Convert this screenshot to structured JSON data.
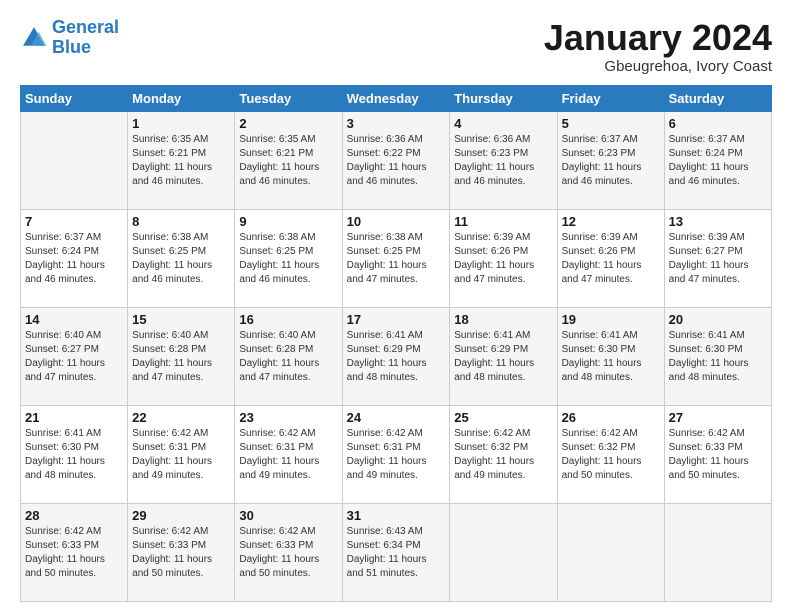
{
  "header": {
    "logo_line1": "General",
    "logo_line2": "Blue",
    "month": "January 2024",
    "location": "Gbeugrehoa, Ivory Coast"
  },
  "weekdays": [
    "Sunday",
    "Monday",
    "Tuesday",
    "Wednesday",
    "Thursday",
    "Friday",
    "Saturday"
  ],
  "weeks": [
    [
      {
        "day": "",
        "info": ""
      },
      {
        "day": "1",
        "info": "Sunrise: 6:35 AM\nSunset: 6:21 PM\nDaylight: 11 hours and 46 minutes."
      },
      {
        "day": "2",
        "info": "Sunrise: 6:35 AM\nSunset: 6:21 PM\nDaylight: 11 hours and 46 minutes."
      },
      {
        "day": "3",
        "info": "Sunrise: 6:36 AM\nSunset: 6:22 PM\nDaylight: 11 hours and 46 minutes."
      },
      {
        "day": "4",
        "info": "Sunrise: 6:36 AM\nSunset: 6:23 PM\nDaylight: 11 hours and 46 minutes."
      },
      {
        "day": "5",
        "info": "Sunrise: 6:37 AM\nSunset: 6:23 PM\nDaylight: 11 hours and 46 minutes."
      },
      {
        "day": "6",
        "info": "Sunrise: 6:37 AM\nSunset: 6:24 PM\nDaylight: 11 hours and 46 minutes."
      }
    ],
    [
      {
        "day": "7",
        "info": "Sunrise: 6:37 AM\nSunset: 6:24 PM\nDaylight: 11 hours and 46 minutes."
      },
      {
        "day": "8",
        "info": "Sunrise: 6:38 AM\nSunset: 6:25 PM\nDaylight: 11 hours and 46 minutes."
      },
      {
        "day": "9",
        "info": "Sunrise: 6:38 AM\nSunset: 6:25 PM\nDaylight: 11 hours and 46 minutes."
      },
      {
        "day": "10",
        "info": "Sunrise: 6:38 AM\nSunset: 6:25 PM\nDaylight: 11 hours and 47 minutes."
      },
      {
        "day": "11",
        "info": "Sunrise: 6:39 AM\nSunset: 6:26 PM\nDaylight: 11 hours and 47 minutes."
      },
      {
        "day": "12",
        "info": "Sunrise: 6:39 AM\nSunset: 6:26 PM\nDaylight: 11 hours and 47 minutes."
      },
      {
        "day": "13",
        "info": "Sunrise: 6:39 AM\nSunset: 6:27 PM\nDaylight: 11 hours and 47 minutes."
      }
    ],
    [
      {
        "day": "14",
        "info": "Sunrise: 6:40 AM\nSunset: 6:27 PM\nDaylight: 11 hours and 47 minutes."
      },
      {
        "day": "15",
        "info": "Sunrise: 6:40 AM\nSunset: 6:28 PM\nDaylight: 11 hours and 47 minutes."
      },
      {
        "day": "16",
        "info": "Sunrise: 6:40 AM\nSunset: 6:28 PM\nDaylight: 11 hours and 47 minutes."
      },
      {
        "day": "17",
        "info": "Sunrise: 6:41 AM\nSunset: 6:29 PM\nDaylight: 11 hours and 48 minutes."
      },
      {
        "day": "18",
        "info": "Sunrise: 6:41 AM\nSunset: 6:29 PM\nDaylight: 11 hours and 48 minutes."
      },
      {
        "day": "19",
        "info": "Sunrise: 6:41 AM\nSunset: 6:30 PM\nDaylight: 11 hours and 48 minutes."
      },
      {
        "day": "20",
        "info": "Sunrise: 6:41 AM\nSunset: 6:30 PM\nDaylight: 11 hours and 48 minutes."
      }
    ],
    [
      {
        "day": "21",
        "info": "Sunrise: 6:41 AM\nSunset: 6:30 PM\nDaylight: 11 hours and 48 minutes."
      },
      {
        "day": "22",
        "info": "Sunrise: 6:42 AM\nSunset: 6:31 PM\nDaylight: 11 hours and 49 minutes."
      },
      {
        "day": "23",
        "info": "Sunrise: 6:42 AM\nSunset: 6:31 PM\nDaylight: 11 hours and 49 minutes."
      },
      {
        "day": "24",
        "info": "Sunrise: 6:42 AM\nSunset: 6:31 PM\nDaylight: 11 hours and 49 minutes."
      },
      {
        "day": "25",
        "info": "Sunrise: 6:42 AM\nSunset: 6:32 PM\nDaylight: 11 hours and 49 minutes."
      },
      {
        "day": "26",
        "info": "Sunrise: 6:42 AM\nSunset: 6:32 PM\nDaylight: 11 hours and 50 minutes."
      },
      {
        "day": "27",
        "info": "Sunrise: 6:42 AM\nSunset: 6:33 PM\nDaylight: 11 hours and 50 minutes."
      }
    ],
    [
      {
        "day": "28",
        "info": "Sunrise: 6:42 AM\nSunset: 6:33 PM\nDaylight: 11 hours and 50 minutes."
      },
      {
        "day": "29",
        "info": "Sunrise: 6:42 AM\nSunset: 6:33 PM\nDaylight: 11 hours and 50 minutes."
      },
      {
        "day": "30",
        "info": "Sunrise: 6:42 AM\nSunset: 6:33 PM\nDaylight: 11 hours and 50 minutes."
      },
      {
        "day": "31",
        "info": "Sunrise: 6:43 AM\nSunset: 6:34 PM\nDaylight: 11 hours and 51 minutes."
      },
      {
        "day": "",
        "info": ""
      },
      {
        "day": "",
        "info": ""
      },
      {
        "day": "",
        "info": ""
      }
    ]
  ]
}
